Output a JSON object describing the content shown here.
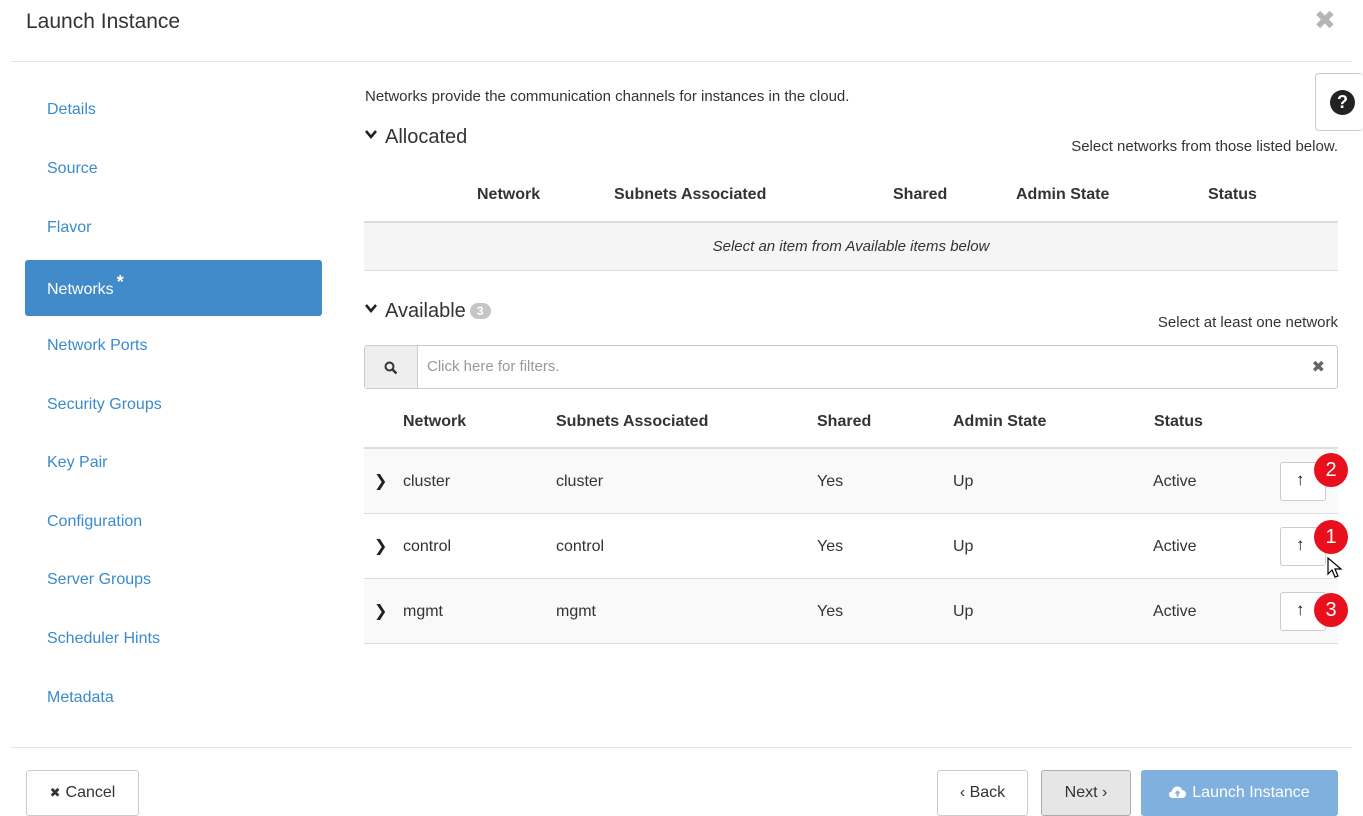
{
  "dialog": {
    "title": "Launch Instance",
    "close_icon": "close-icon",
    "help_icon": "question-circle-icon",
    "help_glyph": "?"
  },
  "sidebar": {
    "items": [
      {
        "label": "Details"
      },
      {
        "label": "Source"
      },
      {
        "label": "Flavor"
      },
      {
        "label": "Networks",
        "required": "*",
        "active": true
      },
      {
        "label": "Network Ports"
      },
      {
        "label": "Security Groups"
      },
      {
        "label": "Key Pair"
      },
      {
        "label": "Configuration"
      },
      {
        "label": "Server Groups"
      },
      {
        "label": "Scheduler Hints"
      },
      {
        "label": "Metadata"
      }
    ]
  },
  "main": {
    "description": "Networks provide the communication channels for instances in the cloud.",
    "allocated": {
      "title": "Allocated",
      "hint": "Select networks from those listed below.",
      "columns": [
        "Network",
        "Subnets Associated",
        "Shared",
        "Admin State",
        "Status"
      ],
      "empty_text": "Select an item from Available items below"
    },
    "available": {
      "title": "Available",
      "count": "3",
      "hint": "Select at least one network",
      "filter_placeholder": "Click here for filters.",
      "columns": [
        "Network",
        "Subnets Associated",
        "Shared",
        "Admin State",
        "Status"
      ],
      "rows": [
        {
          "network": "cluster",
          "subnets": "cluster",
          "shared": "Yes",
          "admin_state": "Up",
          "status": "Active",
          "marker": "2"
        },
        {
          "network": "control",
          "subnets": "control",
          "shared": "Yes",
          "admin_state": "Up",
          "status": "Active",
          "marker": "1"
        },
        {
          "network": "mgmt",
          "subnets": "mgmt",
          "shared": "Yes",
          "admin_state": "Up",
          "status": "Active",
          "marker": "3"
        }
      ]
    }
  },
  "footer": {
    "cancel_label": "Cancel",
    "back_label": "‹ Back",
    "next_label": "Next ›",
    "launch_label": "Launch Instance"
  },
  "colors": {
    "accent": "#428bca",
    "link": "#3a8ace",
    "launch_button": "#7fb0de",
    "marker": "#e8101c"
  }
}
